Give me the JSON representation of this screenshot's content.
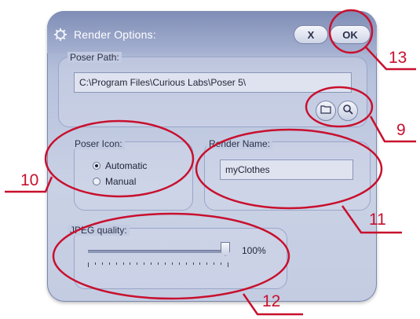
{
  "window": {
    "title": "Render Options:",
    "icon": "settings-figure-icon",
    "buttons": {
      "close_label": "X",
      "ok_label": "OK"
    }
  },
  "poser_path": {
    "label": "Poser Path:",
    "value": "C:\\Program Files\\Curious Labs\\Poser 5\\",
    "open_icon": "folder-icon",
    "find_icon": "magnifier-icon"
  },
  "poser_icon": {
    "label": "Poser Icon:",
    "options": [
      {
        "label": "Automatic",
        "selected": true
      },
      {
        "label": "Manual",
        "selected": false
      }
    ]
  },
  "render_name": {
    "label": "Render Name:",
    "value": "myClothes"
  },
  "jpeg_quality": {
    "label": "JPEG quality:",
    "value_text": "100%",
    "level": 1.0
  },
  "annotations": [
    "13",
    "9",
    "10",
    "11",
    "12"
  ],
  "colors": {
    "annotation": "#c8102e",
    "title_bar": "#8e9cc3"
  }
}
